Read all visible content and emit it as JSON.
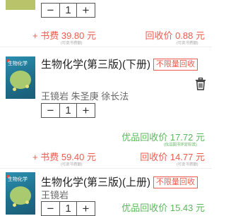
{
  "item0": {
    "qty": "1",
    "fee_prefix": "+ 书费",
    "fee_value": "39.80 元",
    "fee_note": "(可卖书费额)",
    "recycle_label": "回收价",
    "recycle_value": "0.88 元",
    "recycle_note": "(可卖书费额)"
  },
  "item1": {
    "cover_text": "生物化学",
    "title": "生物化学(第三版)(下册)",
    "tag": "不限量回收",
    "authors": "王镜岩 朱圣庚 徐长法",
    "qty": "1",
    "premium_label": "优品回收价",
    "premium_value": "17.72 元",
    "premium_note": "(优品图书评定标准)",
    "fee_prefix": "+ 书费",
    "fee_value": "59.40 元",
    "fee_note": "(可卖书费额)",
    "recycle_label": "回收价",
    "recycle_value": "14.77 元",
    "recycle_note": "(可卖书费额)"
  },
  "item2": {
    "cover_text": "生物化学",
    "title": "生物化学(第三版)(上册)",
    "tag": "不限量回收",
    "authors": "王镜岩",
    "qty": "1",
    "premium_label": "优品回收价",
    "premium_value": "15.43 元"
  },
  "icons": {
    "minus": "−",
    "plus": "+",
    "trash": "trash-icon"
  }
}
